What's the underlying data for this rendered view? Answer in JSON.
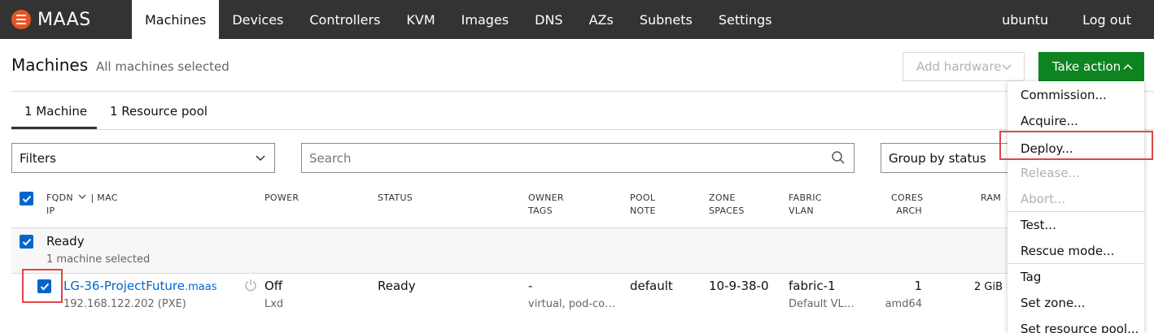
{
  "nav": {
    "brand": "MAAS",
    "items": [
      {
        "label": "Machines",
        "active": true
      },
      {
        "label": "Devices"
      },
      {
        "label": "Controllers"
      },
      {
        "label": "KVM"
      },
      {
        "label": "Images"
      },
      {
        "label": "DNS"
      },
      {
        "label": "AZs"
      },
      {
        "label": "Subnets"
      },
      {
        "label": "Settings"
      }
    ],
    "user": "ubuntu",
    "logout": "Log out"
  },
  "header": {
    "title": "Machines",
    "subtitle": "All machines selected",
    "add_hardware": "Add hardware",
    "take_action": "Take action"
  },
  "tabs": [
    "1 Machine",
    "1 Resource pool"
  ],
  "filters": {
    "filters_label": "Filters",
    "search_placeholder": "Search",
    "group_by": "Group by status"
  },
  "table": {
    "headers": {
      "fqdn": "FQDN",
      "mac": "| MAC",
      "ip": "IP",
      "power": "POWER",
      "status": "STATUS",
      "owner": "OWNER",
      "tags": "TAGS",
      "pool": "POOL",
      "note": "NOTE",
      "zone": "ZONE",
      "spaces": "SPACES",
      "fabric": "FABRIC",
      "vlan": "VLAN",
      "cores": "CORES",
      "arch": "ARCH",
      "ram": "RAM"
    },
    "group": {
      "name": "Ready",
      "selected_text": "1 machine selected"
    },
    "row": {
      "hostname": "LG-36-ProjectFuture",
      "domain": ".maas",
      "ip": "192.168.122.202 (PXE)",
      "power": "Off",
      "power_type": "Lxd",
      "status": "Ready",
      "owner": "-",
      "tags": "virtual, pod-co…",
      "pool": "default",
      "zone": "10-9-38-0",
      "fabric": "fabric-1",
      "vlan": "Default VL…",
      "cores": "1",
      "arch": "amd64",
      "ram": "2 GiB"
    }
  },
  "dropdown": {
    "items": [
      {
        "label": "Commission...",
        "disabled": false
      },
      {
        "label": "Acquire...",
        "disabled": false
      },
      {
        "label": "Deploy...",
        "disabled": false
      },
      {
        "label": "Release...",
        "disabled": true
      },
      {
        "label": "Abort...",
        "disabled": true
      },
      {
        "label": "Test...",
        "disabled": false
      },
      {
        "label": "Rescue mode...",
        "disabled": false
      },
      {
        "label": "Tag",
        "disabled": false
      },
      {
        "label": "Set zone...",
        "disabled": false
      },
      {
        "label": "Set resource pool...",
        "disabled": false
      }
    ]
  },
  "colors": {
    "nav_bg": "#333333",
    "brand_orange": "#e95420",
    "action_green": "#0e8420",
    "checkbox_blue": "#0066cc",
    "highlight_red": "#e04545"
  }
}
